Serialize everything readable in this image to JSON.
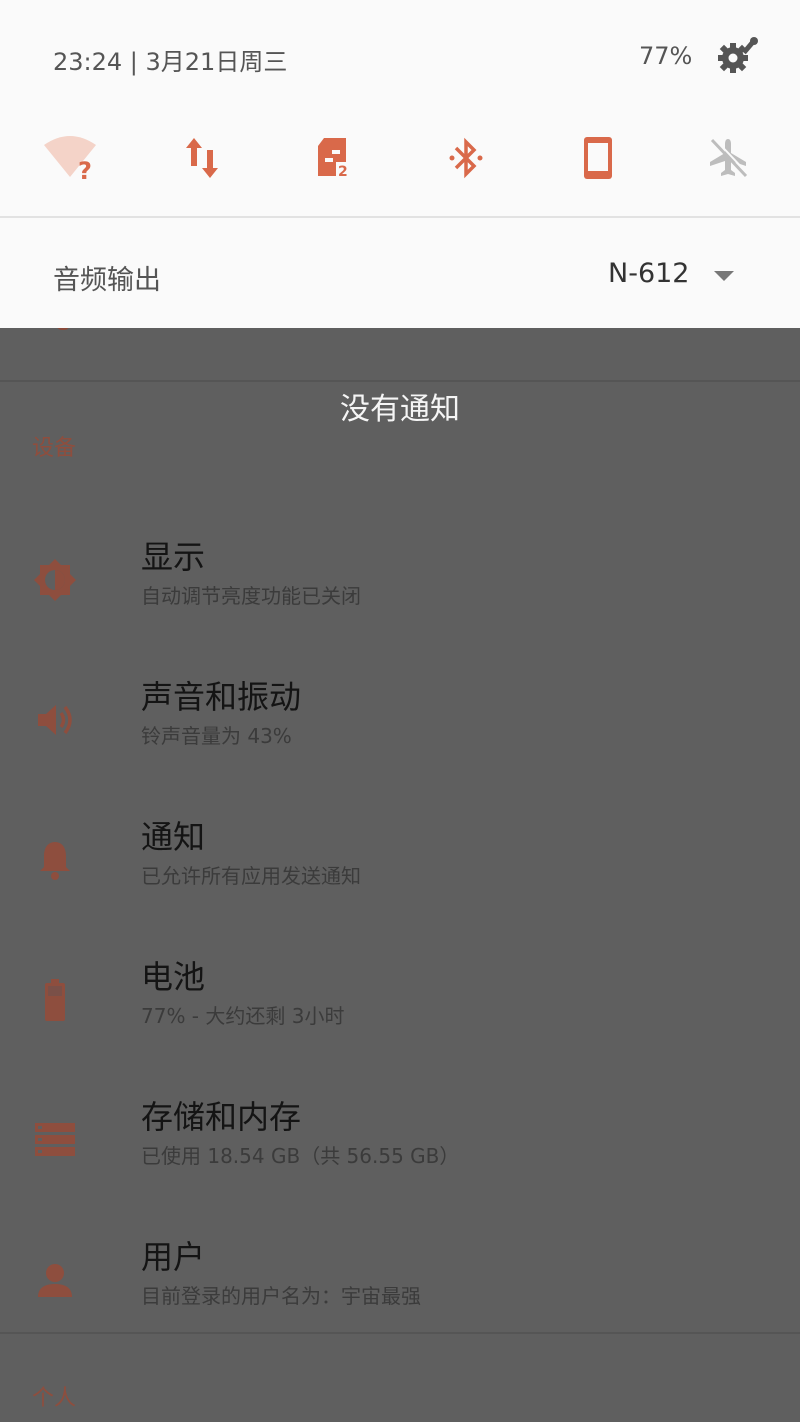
{
  "status": {
    "time_date": "23:24 | 3月21日周三",
    "battery": "77%"
  },
  "quick_tiles": [
    {
      "name": "wifi",
      "icon": "wifi-unknown-icon"
    },
    {
      "name": "mobile-data",
      "icon": "data-arrows-icon"
    },
    {
      "name": "sim-2",
      "icon": "sim-card-icon",
      "badge": "2"
    },
    {
      "name": "bluetooth",
      "icon": "bluetooth-icon"
    },
    {
      "name": "rotation",
      "icon": "phone-portrait-icon"
    },
    {
      "name": "airplane",
      "icon": "airplane-icon"
    }
  ],
  "audio_output": {
    "label": "音频输出",
    "value": "N-612"
  },
  "notifications": {
    "empty_text": "没有通知"
  },
  "settings": {
    "section_device": "设备",
    "items": [
      {
        "title": "显示",
        "summary": "自动调节亮度功能已关闭",
        "icon": "brightness-icon"
      },
      {
        "title": "声音和振动",
        "summary": "铃声音量为 43%",
        "icon": "volume-icon"
      },
      {
        "title": "通知",
        "summary": "已允许所有应用发送通知",
        "icon": "bell-icon"
      },
      {
        "title": "电池",
        "summary": "77% - 大约还剩 3小时",
        "icon": "battery-icon"
      },
      {
        "title": "存储和内存",
        "summary": "已使用 18.54 GB（共 56.55 GB）",
        "icon": "storage-icon"
      },
      {
        "title": "用户",
        "summary": "目前登录的用户名为：宇宙最强",
        "icon": "user-icon"
      }
    ],
    "section_personal": "个人"
  },
  "colors": {
    "accent": "#d9694a",
    "accent_dim": "#8e4e3e",
    "shade_bg": "#fafafa",
    "scrim_bg": "#5f5f5f"
  }
}
